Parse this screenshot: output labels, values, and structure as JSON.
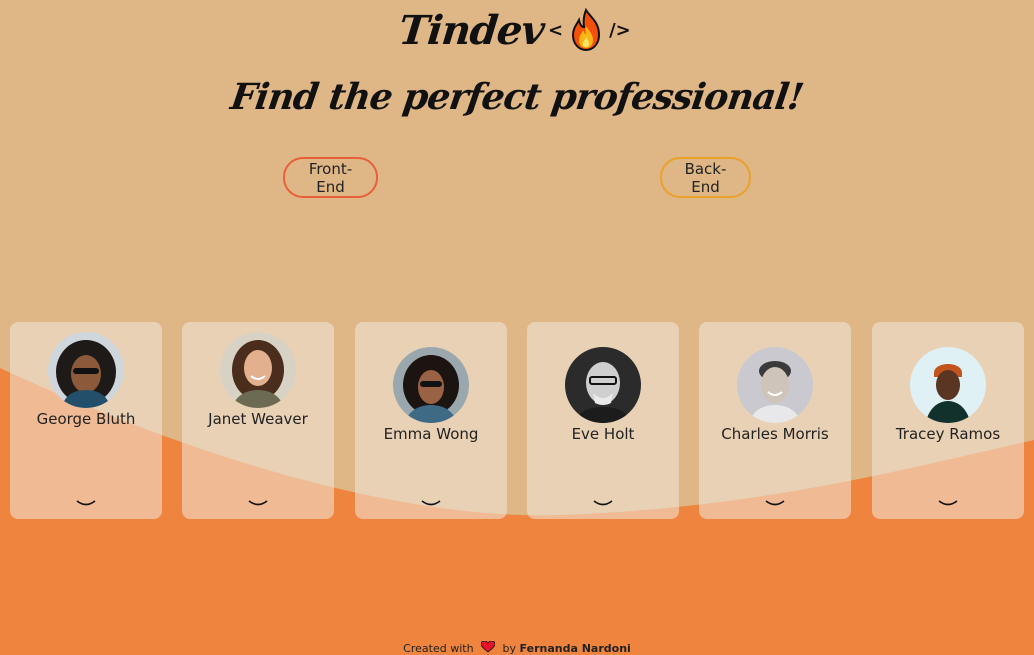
{
  "header": {
    "logo_text": "Tindev",
    "logo_tag_open": "<",
    "logo_tag_close": "/>",
    "logo_icon": "fire-icon",
    "tagline": "Find the perfect professional!"
  },
  "filters": {
    "front_end": "Front-End",
    "back_end": "Back-End"
  },
  "cards": [
    {
      "name": "George Bluth",
      "avatar": "george-bluth-avatar"
    },
    {
      "name": "Janet Weaver",
      "avatar": "janet-weaver-avatar"
    },
    {
      "name": "Emma Wong",
      "avatar": "emma-wong-avatar"
    },
    {
      "name": "Eve Holt",
      "avatar": "eve-holt-avatar"
    },
    {
      "name": "Charles Morris",
      "avatar": "charles-morris-avatar"
    },
    {
      "name": "Tracey Ramos",
      "avatar": "tracey-ramos-avatar"
    }
  ],
  "footer": {
    "prefix": "Created with",
    "by": "by",
    "author": "Fernanda Nardoni",
    "icon": "heart-icon"
  },
  "colors": {
    "background_top": "#dfb685",
    "background_bottom": "#ee843d",
    "front_end_border": "#e8603a",
    "back_end_border": "#e8a22a",
    "card_background": "#f0e7dc"
  }
}
